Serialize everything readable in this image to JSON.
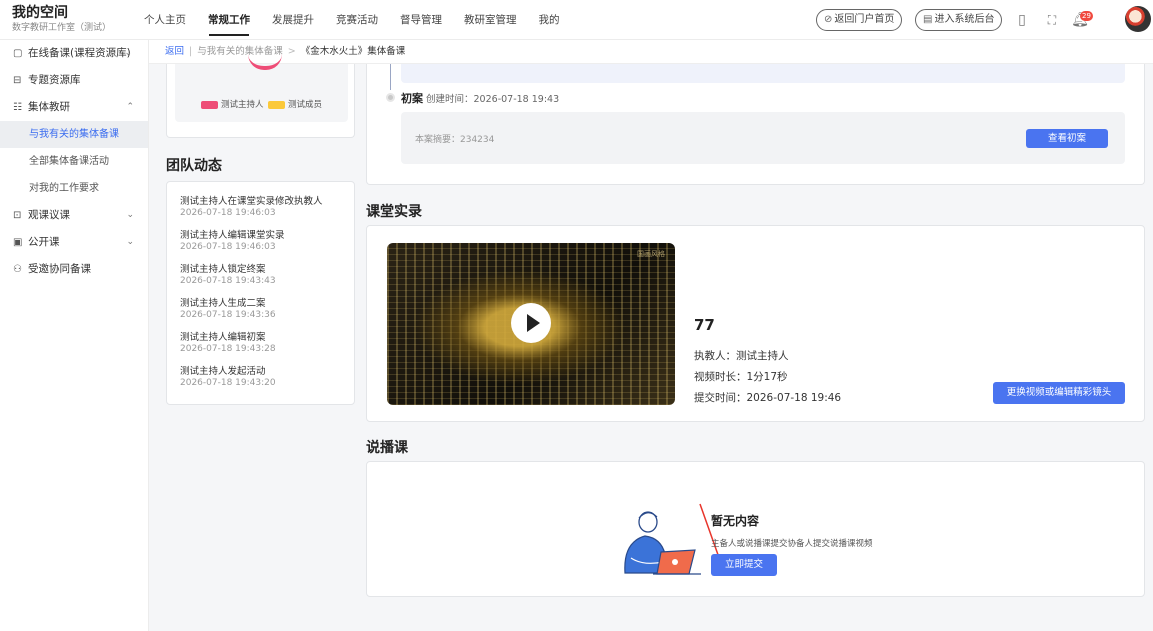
{
  "brand": {
    "title": "我的空间",
    "subtitle": "数字教研工作室（测试）"
  },
  "nav": {
    "items": [
      {
        "label": "个人主页"
      },
      {
        "label": "常规工作"
      },
      {
        "label": "发展提升"
      },
      {
        "label": "竞赛活动"
      },
      {
        "label": "督导管理"
      },
      {
        "label": "教研室管理"
      },
      {
        "label": "我的"
      }
    ],
    "active_index": 1,
    "portal_button": "返回门户首页",
    "backend_button": "进入系统后台",
    "notify_count": "29"
  },
  "sidebar": {
    "items": [
      {
        "label": "在线备课(课程资源库)",
        "icon": "document-icon",
        "expandable": true
      },
      {
        "label": "专题资源库",
        "icon": "bag-icon",
        "expandable": false
      },
      {
        "label": "集体教研",
        "icon": "grid-icon",
        "expandable": true
      },
      {
        "label": "观课议课",
        "icon": "screen-icon",
        "expandable": true
      },
      {
        "label": "公开课",
        "icon": "board-icon",
        "expandable": true
      },
      {
        "label": "受邀协同备课",
        "icon": "people-icon",
        "expandable": false
      }
    ],
    "subitems": [
      {
        "label": "与我有关的集体备课"
      },
      {
        "label": "全部集体备课活动"
      },
      {
        "label": "对我的工作要求"
      }
    ]
  },
  "breadcrumb": {
    "back": "返回",
    "parent": "与我有关的集体备课",
    "current": "《金木水火土》集体备课"
  },
  "legend": {
    "items": [
      {
        "label": "测试主持人",
        "color": "#ee4d77"
      },
      {
        "label": "测试成员",
        "color": "#fbc93a"
      }
    ]
  },
  "team": {
    "title": "团队动态",
    "events": [
      {
        "text": "测试主持人在课堂实录修改执教人",
        "time": "2026-07-18 19:46:03"
      },
      {
        "text": "测试主持人编辑课堂实录",
        "time": "2026-07-18 19:46:03"
      },
      {
        "text": "测试主持人锁定终案",
        "time": "2026-07-18 19:43:43"
      },
      {
        "text": "测试主持人生成二案",
        "time": "2026-07-18 19:43:36"
      },
      {
        "text": "测试主持人编辑初案",
        "time": "2026-07-18 19:43:28"
      },
      {
        "text": "测试主持人发起活动",
        "time": "2026-07-18 19:43:20"
      }
    ]
  },
  "plan": {
    "title": "初案",
    "time_label": "创建时间：",
    "time": "2026-07-18 19:43",
    "abstract": "本案摘要：234234",
    "view_button": "查看初案"
  },
  "classroom": {
    "section_title": "课堂实录",
    "video_title": "77",
    "watermark": "国画风格",
    "teacher": "执教人：测试主持人",
    "duration": "视频时长：1分17秒",
    "submitted": "提交时间：2026-07-18 19:46",
    "change_button": "更换视频或编辑精彩镜头"
  },
  "speaking": {
    "section_title": "说播课",
    "empty_title": "暂无内容",
    "empty_desc": "主备人或说播课提交协备人提交说播课视频",
    "submit_button": "立即提交"
  }
}
